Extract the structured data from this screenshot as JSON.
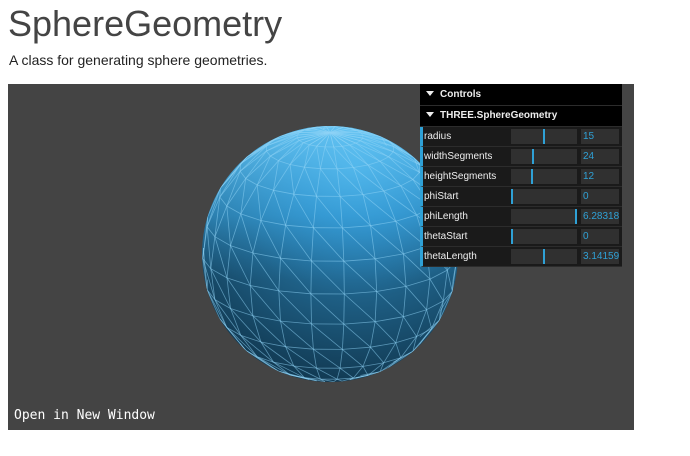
{
  "page": {
    "title": "SphereGeometry",
    "description": "A class for generating sphere geometries."
  },
  "viewport": {
    "open_link": "Open in New Window",
    "background_color": "#444444",
    "sphere_color": "#2194ce"
  },
  "gui": {
    "controls_label": "Controls",
    "folder_label": "THREE.SphereGeometry",
    "accent_color": "#2fa1d6",
    "params": [
      {
        "key": "radius",
        "label": "radius",
        "value": "15",
        "fraction": 0.5
      },
      {
        "key": "widthSegments",
        "label": "widthSegments",
        "value": "24",
        "fraction": 0.34
      },
      {
        "key": "heightSegments",
        "label": "heightSegments",
        "value": "12",
        "fraction": 0.32
      },
      {
        "key": "phiStart",
        "label": "phiStart",
        "value": "0",
        "fraction": 0.0
      },
      {
        "key": "phiLength",
        "label": "phiLength",
        "value": "6.28318",
        "fraction": 1.0
      },
      {
        "key": "thetaStart",
        "label": "thetaStart",
        "value": "0",
        "fraction": 0.0
      },
      {
        "key": "thetaLength",
        "label": "thetaLength",
        "value": "3.14159",
        "fraction": 0.5
      }
    ]
  }
}
